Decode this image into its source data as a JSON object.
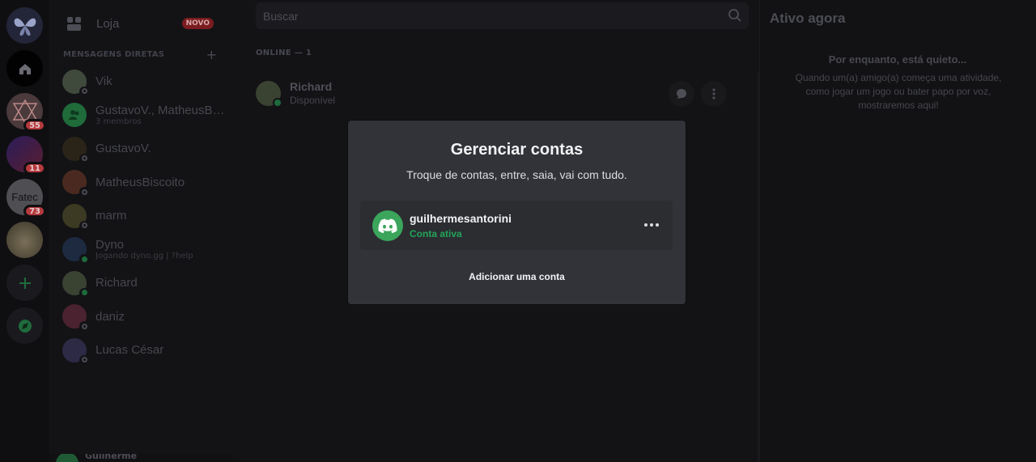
{
  "servers": [
    {
      "name": "server-butterfly",
      "color": "#2a2d44",
      "badge": ""
    },
    {
      "name": "direct-messages-home",
      "color": "#020203",
      "badge": ""
    },
    {
      "name": "server-geometry",
      "color": "#4a3a3c",
      "badge": "55"
    },
    {
      "name": "server-anime",
      "color": "#20307a",
      "badge": "11"
    },
    {
      "name": "server-fatec",
      "color": "#4f4f53",
      "badge": "73",
      "label": "Fatec"
    },
    {
      "name": "server-cat",
      "color": "#5a5140",
      "badge": ""
    }
  ],
  "sidebar": {
    "shop_label": "Loja",
    "shop_badge": "NOVO",
    "dm_header": "MENSAGENS DIRETAS",
    "dms": [
      {
        "name": "Vik",
        "sub": "",
        "color": "#3f4a3c",
        "status": "offline"
      },
      {
        "name": "GustavoV., MatheusBi...",
        "sub": "3 membros",
        "color": "#1f6b3a",
        "status": "group"
      },
      {
        "name": "GustavoV.",
        "sub": "",
        "color": "#2a2418",
        "status": "offline"
      },
      {
        "name": "MatheusBiscoito",
        "sub": "",
        "color": "#4a2a20",
        "status": "offline"
      },
      {
        "name": "marm",
        "sub": "",
        "color": "#3c3a22",
        "status": "offline"
      },
      {
        "name": "Dyno",
        "sub": "Jogando dyno.gg | ?help",
        "color": "#1d2a40",
        "status": "online"
      },
      {
        "name": "Richard",
        "sub": "",
        "color": "#3a4232",
        "status": "online"
      },
      {
        "name": "daniz",
        "sub": "",
        "color": "#4a2230",
        "status": "offline"
      },
      {
        "name": "Lucas César",
        "sub": "",
        "color": "#2c2a44",
        "status": "offline"
      }
    ],
    "user_name": "Guilherme"
  },
  "main": {
    "search_placeholder": "Buscar",
    "online_header": "ONLINE — 1",
    "friend": {
      "name": "Richard",
      "status": "Disponível"
    }
  },
  "active_now": {
    "title": "Ativo agora",
    "quiet": "Por enquanto, está quieto...",
    "desc": "Quando um(a) amigo(a) começa uma atividade, como jogar um jogo ou bater papo por voz, mostraremos aqui!"
  },
  "modal": {
    "title": "Gerenciar contas",
    "subtitle": "Troque de contas, entre, saia, vai com tudo.",
    "account": {
      "username": "guilhermesantorini",
      "status": "Conta ativa"
    },
    "add_account": "Adicionar uma conta"
  },
  "colors": {
    "accent_green": "#23a55a",
    "badge_red": "#b5393d",
    "modal_bg": "#313338"
  }
}
